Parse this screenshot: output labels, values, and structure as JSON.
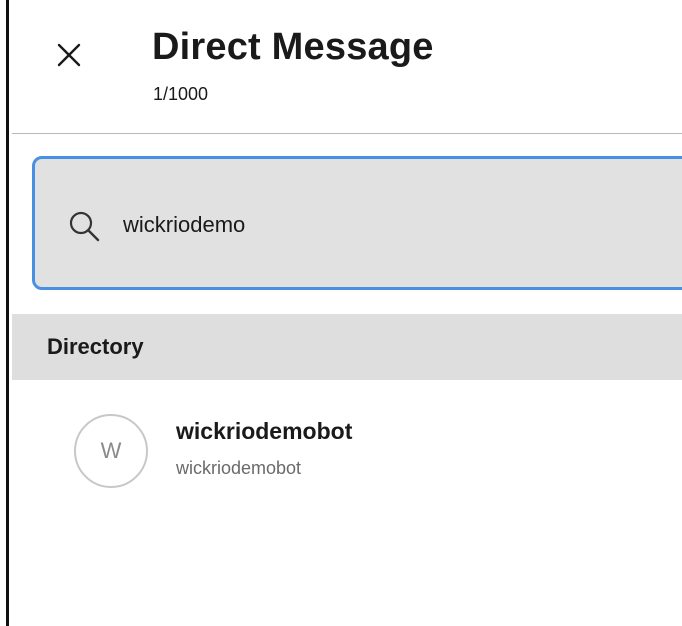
{
  "header": {
    "title": "Direct Message",
    "subtitle": "1/1000"
  },
  "search": {
    "value": "wickriodemo"
  },
  "directory": {
    "title": "Directory",
    "items": [
      {
        "avatar_letter": "W",
        "name": "wickriodemobot",
        "handle": "wickriodemobot"
      }
    ]
  },
  "colors": {
    "accent": "#4a90e2",
    "search_bg": "#e1e1e1",
    "section_bg": "#dedede",
    "spellcheck": "#e05252"
  },
  "icons": {
    "close": "close-icon",
    "search": "search-icon"
  }
}
